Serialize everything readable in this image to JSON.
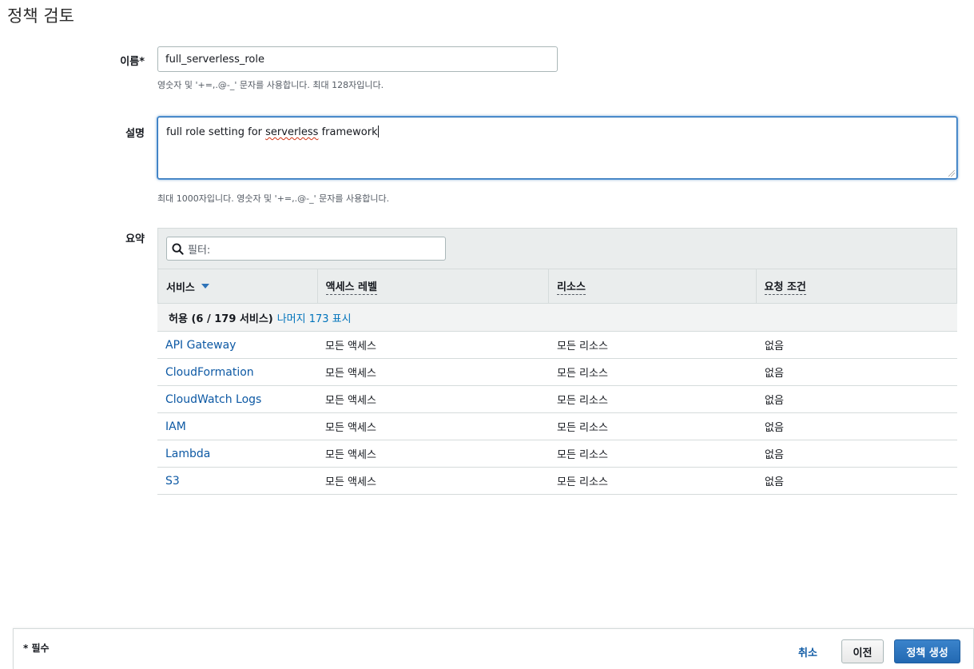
{
  "page": {
    "title": "정책 검토"
  },
  "name_field": {
    "label": "이름*",
    "value": "full_serverless_role",
    "hint": "영숫자 및 '+=,.@-_' 문자를 사용합니다. 최대 128자입니다."
  },
  "description_field": {
    "label": "설명",
    "value_before": "full role setting for ",
    "value_misspelled": "serverless",
    "value_after": " framework",
    "hint": "최대 1000자입니다. 영숫자 및 '+=,.@-_' 문자를 사용합니다."
  },
  "summary": {
    "label": "요약",
    "filter_placeholder": "필터:",
    "columns": [
      "서비스",
      "액세스 레벨",
      "리소스",
      "요청 조건"
    ],
    "group": {
      "label": "허용 (6 / 179 서비스)",
      "link": "나머지 173 표시"
    },
    "rows": [
      {
        "service": "API Gateway",
        "access": "모든 액세스",
        "resource": "모든 리소스",
        "condition": "없음"
      },
      {
        "service": "CloudFormation",
        "access": "모든 액세스",
        "resource": "모든 리소스",
        "condition": "없음"
      },
      {
        "service": "CloudWatch Logs",
        "access": "모든 액세스",
        "resource": "모든 리소스",
        "condition": "없음"
      },
      {
        "service": "IAM",
        "access": "모든 액세스",
        "resource": "모든 리소스",
        "condition": "없음"
      },
      {
        "service": "Lambda",
        "access": "모든 액세스",
        "resource": "모든 리소스",
        "condition": "없음"
      },
      {
        "service": "S3",
        "access": "모든 액세스",
        "resource": "모든 리소스",
        "condition": "없음"
      }
    ]
  },
  "footer": {
    "required_note": "* 필수",
    "cancel_label": "취소",
    "previous_label": "이전",
    "create_label": "정책 생성"
  },
  "colors": {
    "link": "#0d59a4",
    "primary": "#2369b2",
    "focus": "#2e73b8"
  },
  "icons": {
    "filter": "search-icon",
    "sort": "caret-down-icon"
  }
}
